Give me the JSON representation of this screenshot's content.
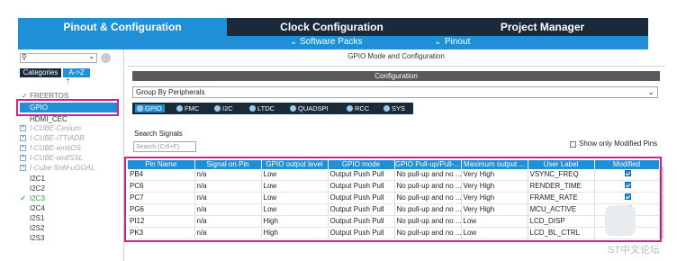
{
  "tabs": {
    "pinout": "Pinout & Configuration",
    "clock": "Clock Configuration",
    "project": "Project Manager"
  },
  "subbar": {
    "software_packs": "Software Packs",
    "pinout": "Pinout"
  },
  "left": {
    "tab_categories": "Categories",
    "tab_az": "A->Z",
    "items": [
      "FREERTOS",
      "GPIO",
      "HDMI_CEC",
      "I-CUBE-Cesium",
      "I-CUBE-ITTIADB",
      "I-CUBE-embOS",
      "I-CUBE-wolfSSL",
      "I-Cube-SoM-uGOAL",
      "I2C1",
      "I2C2",
      "I2C3",
      "I2C4",
      "I2S1",
      "I2S2",
      "I2S3"
    ]
  },
  "main": {
    "title": "GPIO Mode and Configuration",
    "config": "Configuration",
    "group_by": "Group By Peripherals",
    "pills": [
      "GPIO",
      "FMC",
      "I2C",
      "LTDC",
      "QUADSPI",
      "RCC",
      "SYS"
    ],
    "search_signals": "Search Signals",
    "search_placeholder": "Search (Crtl+F)",
    "show_modified": "Show only Modified Pins"
  },
  "table": {
    "headers": [
      "Pin Name",
      "Signal on Pin",
      "GPIO output level",
      "GPIO mode",
      "GPIO Pull-up/Pull-...",
      "Maximum output ...",
      "User Label",
      "Modified"
    ],
    "rows": [
      [
        "PB4",
        "n/a",
        "Low",
        "Output Push Pull",
        "No pull-up and no ...",
        "Very High",
        "VSYNC_FREQ"
      ],
      [
        "PC6",
        "n/a",
        "Low",
        "Output Push Pull",
        "No pull-up and no ...",
        "Very High",
        "RENDER_TIME"
      ],
      [
        "PC7",
        "n/a",
        "Low",
        "Output Push Pull",
        "No pull-up and no ...",
        "Very High",
        "FRAME_RATE"
      ],
      [
        "PG6",
        "n/a",
        "Low",
        "Output Push Pull",
        "No pull-up and no ...",
        "Very High",
        "MCU_ACTIVE"
      ],
      [
        "PI12",
        "n/a",
        "High",
        "Output Push Pull",
        "No pull-up and no ...",
        "Low",
        "LCD_DISP"
      ],
      [
        "PK3",
        "n/a",
        "High",
        "Output Push Pull",
        "No pull-up and no ...",
        "Low",
        "LCD_BL_CTRL"
      ]
    ]
  },
  "watermark": "ST中文论坛"
}
